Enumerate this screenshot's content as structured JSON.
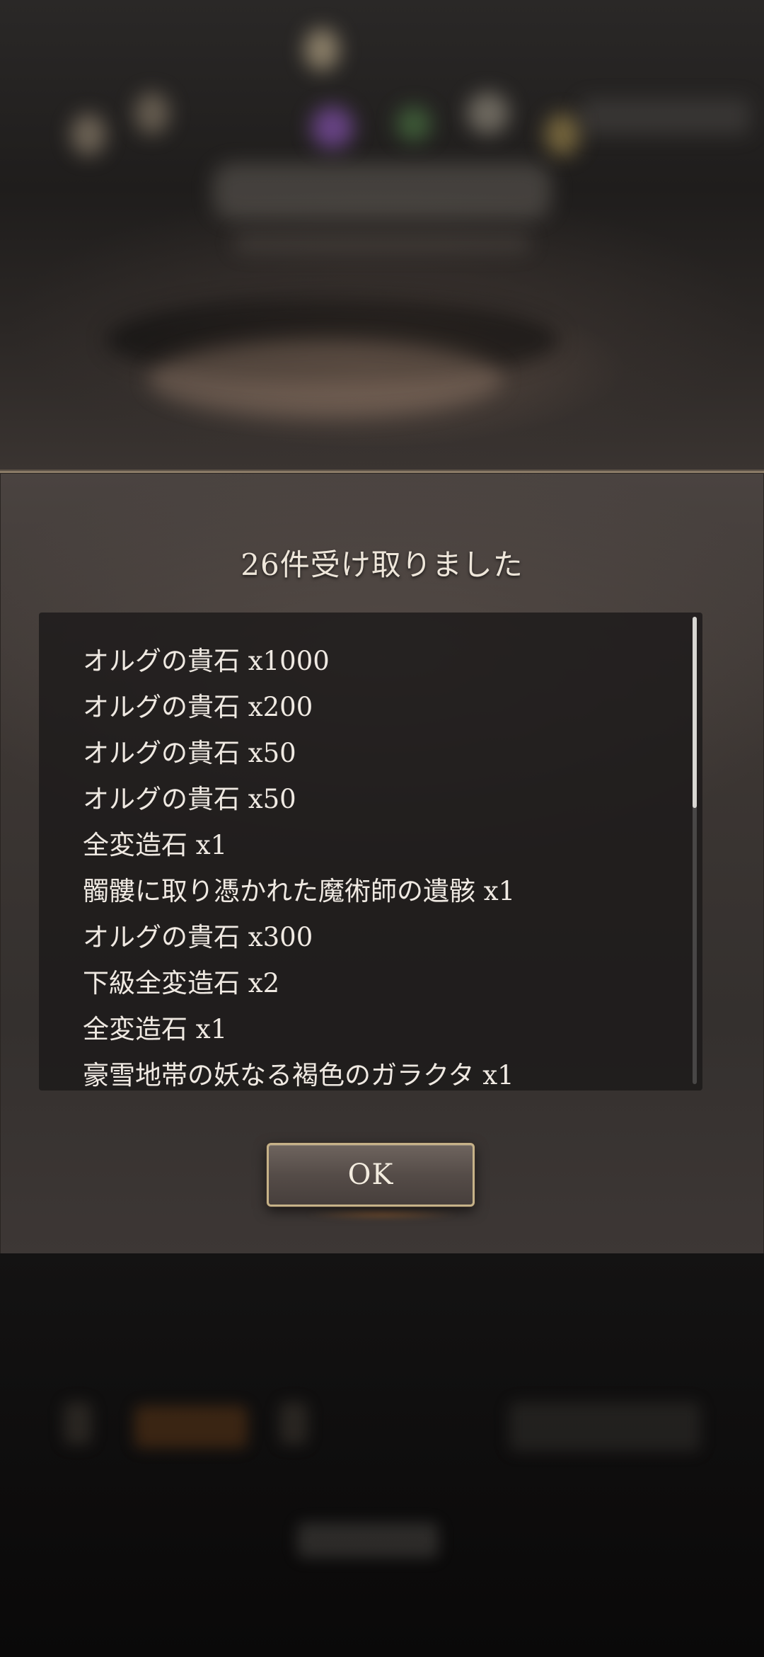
{
  "dialog": {
    "title": "26件受け取りました",
    "items": [
      "オルグの貴石 x1000",
      "オルグの貴石 x200",
      "オルグの貴石 x50",
      "オルグの貴石 x50",
      "全変造石 x1",
      "髑髏に取り憑かれた魔術師の遺骸 x1",
      "オルグの貴石 x300",
      "下級全変造石 x2",
      "全変造石 x1",
      "豪雪地帯の妖なる褐色のガラクタ x1"
    ],
    "ok_label": "OK"
  },
  "colors": {
    "panel_border": "#8a7a66",
    "button_border": "#c6b288",
    "text": "#efe9e2"
  }
}
